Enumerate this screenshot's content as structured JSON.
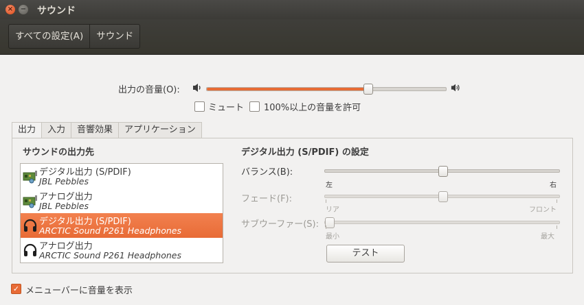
{
  "window": {
    "title": "サウンド",
    "close_glyph": "×",
    "minimize_glyph": "−"
  },
  "breadcrumbs": [
    "すべての設定(A)",
    "サウンド"
  ],
  "output_volume": {
    "label": "出力の音量(O):",
    "level_percent": 68
  },
  "mute": {
    "label": "ミュート",
    "checked": false
  },
  "allow_over_100": {
    "label": "100%以上の音量を許可",
    "checked": false
  },
  "tabs": [
    "出力",
    "入力",
    "音響効果",
    "アプリケーション"
  ],
  "output_section_title": "サウンドの出力先",
  "devices": [
    {
      "name": "デジタル出力 (S/PDIF)",
      "sub": "JBL Pebbles",
      "icon": "audio-card-icon",
      "selected": false
    },
    {
      "name": "アナログ出力",
      "sub": "JBL Pebbles",
      "icon": "audio-card-icon",
      "selected": false
    },
    {
      "name": "デジタル出力 (S/PDIF)",
      "sub": "ARCTIC Sound P261 Headphones",
      "icon": "headphones-icon",
      "selected": true
    },
    {
      "name": "アナログ出力",
      "sub": "ARCTIC Sound P261 Headphones",
      "icon": "headphones-icon",
      "selected": false
    }
  ],
  "settings_title": "デジタル出力 (S/PDIF) の設定",
  "balance": {
    "label": "バランス(B):",
    "left": "左",
    "right": "右",
    "position_percent": 50
  },
  "fade": {
    "label": "フェード(F):",
    "left": "リア",
    "right": "フロント",
    "position_percent": 50
  },
  "subwoofer": {
    "label": "サブウーファー(S):",
    "left": "最小",
    "right": "最大",
    "position_percent": 0
  },
  "test_button": "テスト",
  "show_in_menubar": {
    "label": "メニューバーに音量を表示",
    "checked": true
  },
  "colors": {
    "accent": "#e86b36",
    "titlebar": "#3c3b37",
    "background": "#f2f1f0"
  }
}
